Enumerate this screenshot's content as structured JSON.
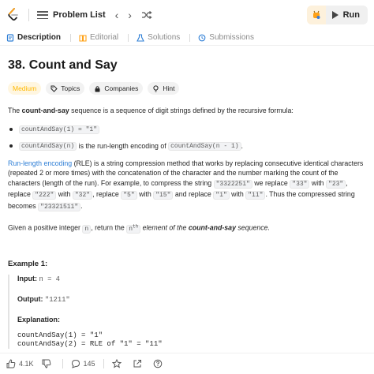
{
  "topbar": {
    "problem_list_label": "Problem List",
    "prev_glyph": "‹",
    "next_glyph": "›",
    "run_label": "Run"
  },
  "tabs": [
    {
      "label": "Description",
      "icon": "description-icon",
      "active": true
    },
    {
      "label": "Editorial",
      "icon": "editorial-icon",
      "active": false
    },
    {
      "label": "Solutions",
      "icon": "solutions-icon",
      "active": false
    },
    {
      "label": "Submissions",
      "icon": "submissions-icon",
      "active": false
    }
  ],
  "problem": {
    "title": "38. Count and Say",
    "difficulty": "Medium",
    "chips": [
      "Topics",
      "Companies",
      "Hint"
    ],
    "intro_pre": "The ",
    "intro_bold": "count-and-say",
    "intro_post": " sequence is a sequence of digit strings defined by the recursive formula:",
    "bullet1_code": "countAndSay(1) = \"1\"",
    "bullet2_code": "countAndSay(n)",
    "bullet2_mid": " is the run-length encoding of ",
    "bullet2_code2": "countAndSay(n - 1)",
    "bullet2_end": ".",
    "rle_link": "Run-length encoding",
    "rle_text1": " (RLE) is a string compression method that works by replacing consecutive identical characters (repeated 2 or more times) with the concatenation of the character and the number marking the count of the characters (length of the run). For example, to compress the string ",
    "rle_c1": "\"3322251\"",
    "rle_t2": " we replace ",
    "rle_c2": "\"33\"",
    "rle_t3": " with ",
    "rle_c3": "\"23\"",
    "rle_t4": ", replace ",
    "rle_c4": "\"222\"",
    "rle_t5": " with ",
    "rle_c5": "\"32\"",
    "rle_t6": ", replace ",
    "rle_c6": "\"5\"",
    "rle_t7": " with ",
    "rle_c7": "\"15\"",
    "rle_t8": " and replace ",
    "rle_c8": "\"1\"",
    "rle_t9": " with ",
    "rle_c9": "\"11\"",
    "rle_t10": ". Thus the compressed string becomes ",
    "rle_c10": "\"23321511\"",
    "rle_t11": ".",
    "given_pre": "Given a positive integer ",
    "given_code": "n",
    "given_mid": ", return the ",
    "given_sup_base": "n",
    "given_sup": "th",
    "given_em": " element of the ",
    "given_bold": "count-and-say",
    "given_end": " sequence."
  },
  "example": {
    "title": "Example 1:",
    "input_label": "Input:",
    "input_value": "n = 4",
    "output_label": "Output:",
    "output_value": "\"1211\"",
    "explanation_label": "Explanation:",
    "code_lines": [
      "countAndSay(1) = \"1\"",
      "countAndSay(2) = RLE of \"1\" = \"11\""
    ]
  },
  "bottombar": {
    "likes": "4.1K",
    "comments": "145"
  },
  "colors": {
    "medium": "#ffb800",
    "link": "#2f7fd6",
    "logo": "#ffa116"
  }
}
